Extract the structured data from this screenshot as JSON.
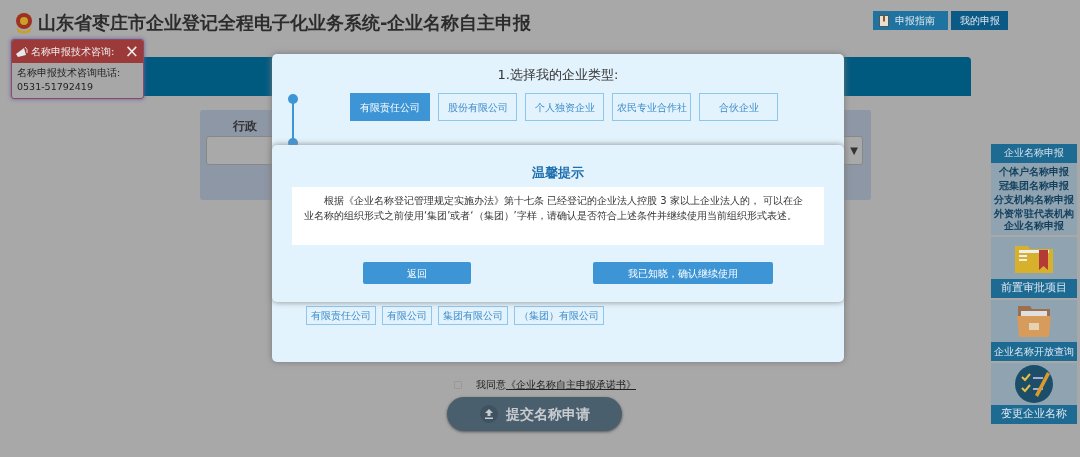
{
  "header": {
    "title": "山东省枣庄市企业登记全程电子化业务系统-企业名称自主申报",
    "buttons": [
      {
        "label": "申报指南",
        "icon": true
      },
      {
        "label": "我的申报",
        "icon": false
      }
    ]
  },
  "consult_popup": {
    "title": "名称申报技术咨询:",
    "close": "×",
    "lines": [
      "名称申报技术咨询电话:",
      "0531-51792419"
    ]
  },
  "background_form": {
    "label": "行政",
    "select_arrow": "▼"
  },
  "type_dialog": {
    "title": "1.选择我的企业类型:",
    "types": [
      {
        "label": "有限责任公司",
        "selected": true
      },
      {
        "label": "股份有限公司",
        "selected": false
      },
      {
        "label": "个人独资企业",
        "selected": false
      },
      {
        "label": "农民专业合作社",
        "selected": false
      },
      {
        "label": "合伙企业",
        "selected": false
      }
    ],
    "org_forms": [
      "有限责任公司",
      "有限公司",
      "集团有限公司",
      "（集团）有限公司"
    ]
  },
  "notice_dialog": {
    "title": "温馨提示",
    "message": "根据《企业名称登记管理规定实施办法》第十七条 已经登记的企业法人控股 3 家以上企业法人的， 可以在企业名称的组织形式之前使用‘集团’或者‘（集团）’字样，请确认是否符合上述条件并继续使用当前组织形式表述。",
    "buttons": [
      "返回",
      "我已知晓，确认继续使用"
    ]
  },
  "agreement": {
    "checked": false,
    "text": "我同意",
    "link": "《企业名称自主申报承诺书》"
  },
  "submit": {
    "label": "提交名称申请"
  },
  "sidebar": {
    "title": "企业名称申报",
    "links": [
      "个体户名称申报",
      "冠集团名称申报",
      "分支机构名称申报",
      "外资常驻代表机构企业名称申报"
    ],
    "tiles": [
      {
        "kind": "folder",
        "label": "前置审批项目"
      },
      {
        "kind": "box",
        "label": "企业名称开放查询"
      },
      {
        "kind": "check",
        "label": "变更企业名称"
      }
    ]
  }
}
